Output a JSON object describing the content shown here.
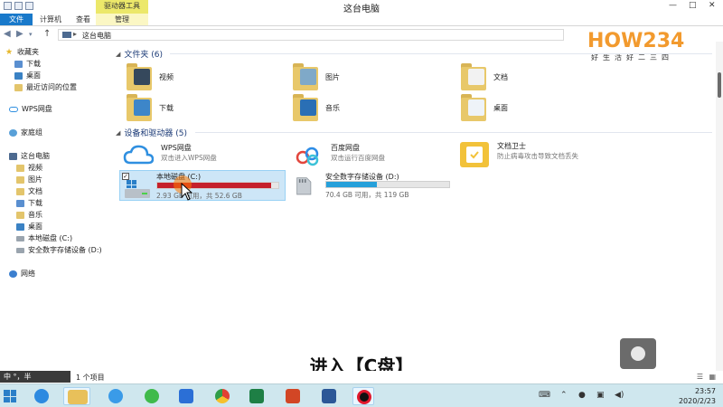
{
  "titlebar": {
    "title": "这台电脑",
    "context_tool": "驱动器工具",
    "controls": [
      "—",
      "□",
      "✕"
    ]
  },
  "ribbon": {
    "tabs": [
      "文件",
      "计算机",
      "查看",
      "管理"
    ]
  },
  "address": {
    "path": "这台电脑"
  },
  "sidebar": {
    "favorites_header": "收藏夹",
    "favorites": [
      "下载",
      "桌面",
      "最近访问的位置"
    ],
    "wps": "WPS网盘",
    "homegroup": "家庭组",
    "thispc": "这台电脑",
    "pc_items": [
      "视频",
      "图片",
      "文档",
      "下载",
      "音乐",
      "桌面",
      "本地磁盘 (C:)",
      "安全数字存储设备 (D:)"
    ],
    "network": "网络"
  },
  "folders": {
    "header": "文件夹 (6)",
    "items": [
      "视频",
      "图片",
      "文档",
      "下载",
      "音乐",
      "桌面"
    ]
  },
  "devices": {
    "header": "设备和驱动器 (5)",
    "items": [
      {
        "name": "WPS网盘",
        "sub": "双击进入WPS网盘"
      },
      {
        "name": "百度网盘",
        "sub": "双击运行百度网盘"
      },
      {
        "name": "文档卫士",
        "sub": "防止病毒攻击导致文档丢失"
      },
      {
        "name": "本地磁盘 (C:)",
        "sub": "2.93 GB 可用，共 52.6 GB",
        "used_fraction": 0.944,
        "bar_color": "#c5202b"
      },
      {
        "name": "安全数字存储设备 (D:)",
        "sub": "70.4 GB 可用，共 119 GB",
        "used_fraction": 0.41,
        "bar_color": "#26a0da"
      }
    ]
  },
  "status": {
    "ime": "中 °，半",
    "count": "1 个项目"
  },
  "subtitle": "进入【C盘】",
  "logo": {
    "main": "HOW234",
    "sub": "好生活好二三四"
  },
  "clock": {
    "time": "23:57",
    "date": "2020/2/23"
  }
}
